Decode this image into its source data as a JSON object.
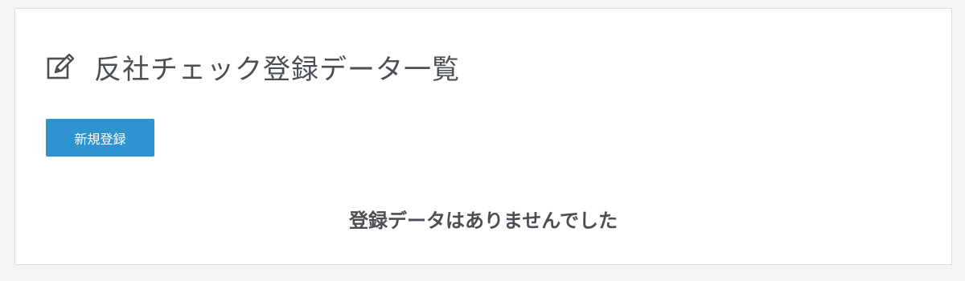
{
  "header": {
    "title": "反社チェック登録データ一覧",
    "icon": "edit-icon"
  },
  "actions": {
    "new_label": "新規登録"
  },
  "main": {
    "empty_message": "登録データはありませんでした"
  },
  "colors": {
    "accent": "#2e93cf",
    "text": "#4a4f55",
    "panel_bg": "#ffffff",
    "page_bg": "#f4f4f4"
  }
}
